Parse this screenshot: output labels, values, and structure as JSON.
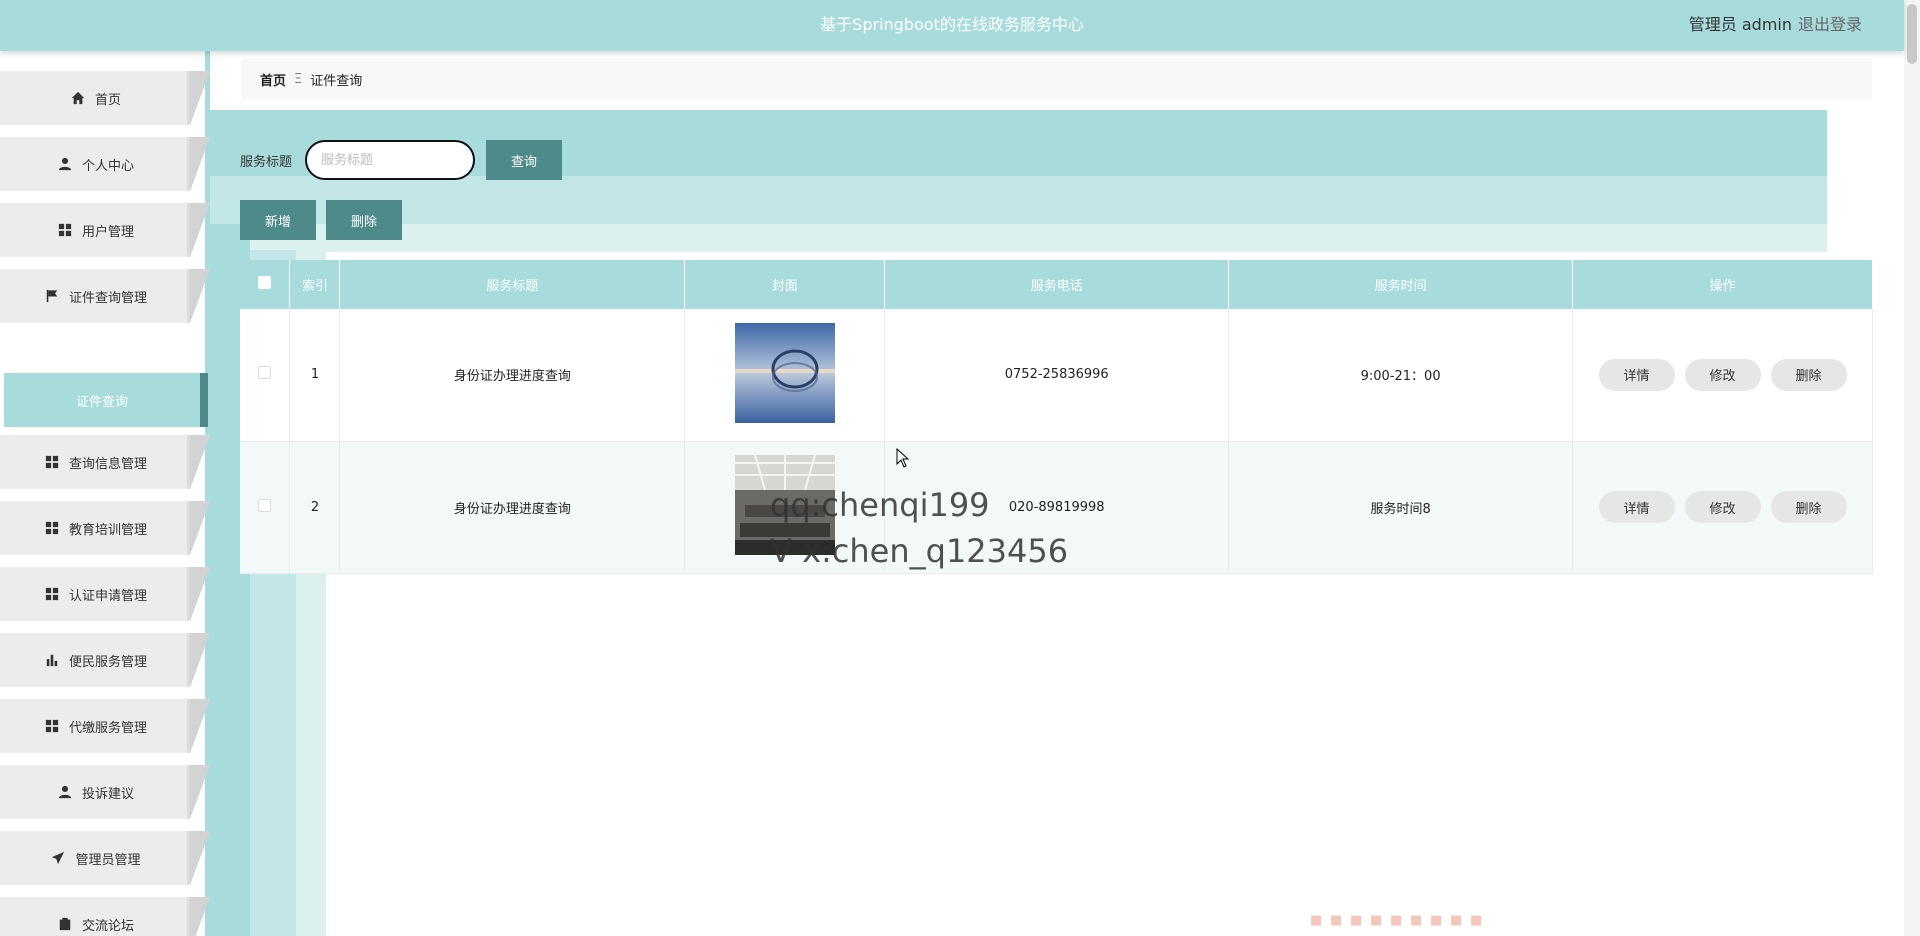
{
  "header": {
    "title": "基于Springboot的在线政务服务中心",
    "user": "管理员 admin",
    "logout": "退出登录"
  },
  "sidebar": {
    "items": [
      {
        "label": "首页",
        "icon": "home-icon"
      },
      {
        "label": "个人中心",
        "icon": "user-icon"
      },
      {
        "label": "用户管理",
        "icon": "grid-icon"
      },
      {
        "label": "证件查询管理",
        "icon": "flag-icon"
      },
      {
        "label": "查询信息管理",
        "icon": "grid-icon"
      },
      {
        "label": "教育培训管理",
        "icon": "grid-icon"
      },
      {
        "label": "认证申请管理",
        "icon": "grid-icon"
      },
      {
        "label": "便民服务管理",
        "icon": "bar-chart-icon"
      },
      {
        "label": "代缴服务管理",
        "icon": "grid-icon"
      },
      {
        "label": "投诉建议",
        "icon": "user-icon"
      },
      {
        "label": "管理员管理",
        "icon": "send-icon"
      },
      {
        "label": "交流论坛",
        "icon": "clipboard-icon"
      }
    ],
    "active_sub": "证件查询"
  },
  "breadcrumb": {
    "home": "首页",
    "separator": "Ξ",
    "current": "证件查询"
  },
  "search": {
    "label": "服务标题",
    "placeholder": "服务标题",
    "button": "查询"
  },
  "actions": {
    "add": "新增",
    "delete": "删除"
  },
  "table": {
    "columns": [
      "索引",
      "服务标题",
      "封面",
      "服务电话",
      "服务时间",
      "操作"
    ],
    "rows": [
      {
        "index": "1",
        "title": "身份证办理进度查询",
        "phone": "0752-25836996",
        "time": "9:00-21：00"
      },
      {
        "index": "2",
        "title": "身份证办理进度查询",
        "phone": "020-89819998",
        "time": "服务时间8"
      }
    ],
    "row_actions": [
      "详情",
      "修改",
      "删除"
    ]
  },
  "watermark": {
    "line1": "qq:chenqi199",
    "line2": "V x:chen_q123456"
  },
  "colors": {
    "accent": "#a8dcdc",
    "button": "#4f8a8b",
    "submenu_border": "#4f8a8b"
  }
}
